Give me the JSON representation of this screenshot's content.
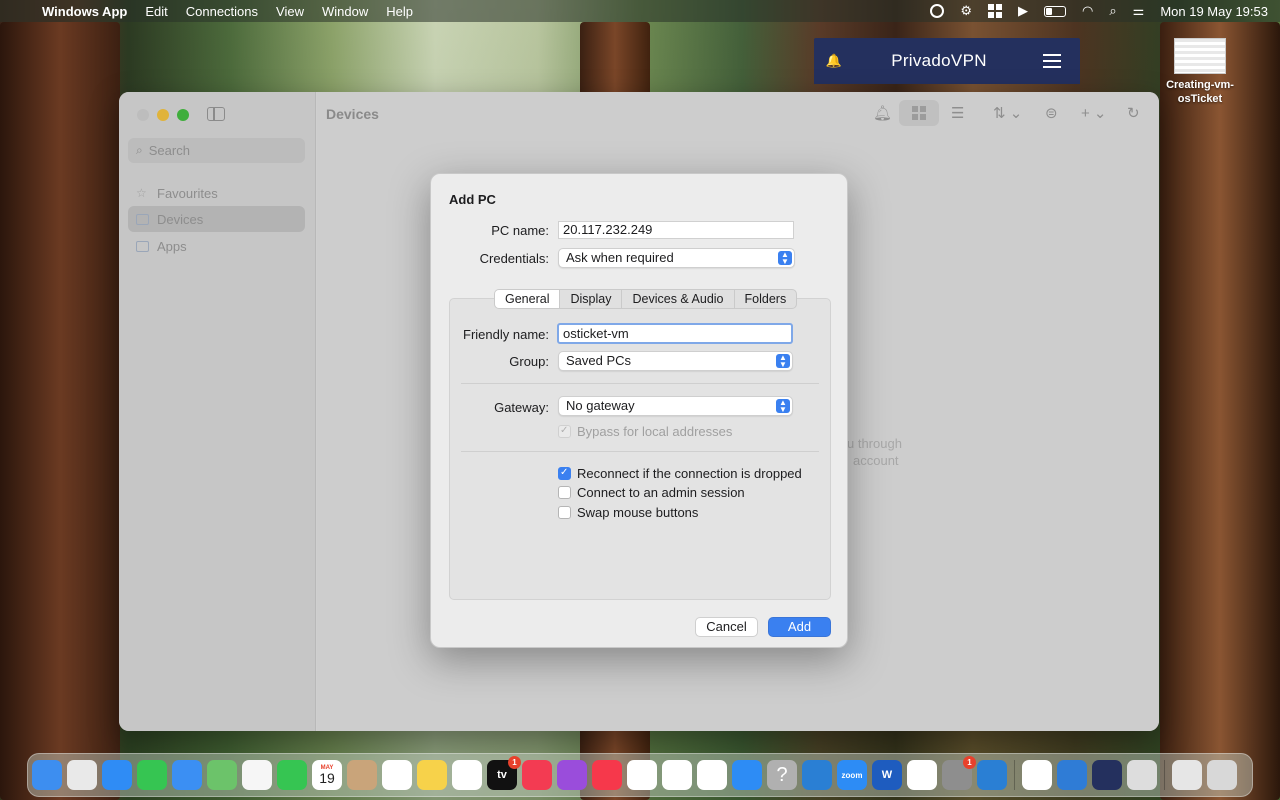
{
  "menubar": {
    "app_name": "Windows App",
    "items": [
      "Edit",
      "Connections",
      "View",
      "Window",
      "Help"
    ],
    "clock": "Mon 19 May  19:53"
  },
  "vpn": {
    "title": "PrivadoVPN"
  },
  "desktop_file": {
    "label": "Creating-vm-osTicket"
  },
  "window": {
    "title": "Devices",
    "search_placeholder": "Search",
    "sidebar": [
      {
        "label": "Favourites",
        "icon": "star-icon"
      },
      {
        "label": "Devices",
        "icon": "monitor-icon"
      },
      {
        "label": "Apps",
        "icon": "apps-grid-icon"
      }
    ],
    "background_hint_line1": "u through",
    "background_hint_line2": "account"
  },
  "dialog": {
    "title": "Add PC",
    "pc_name_label": "PC name:",
    "pc_name_value": "20.117.232.249",
    "credentials_label": "Credentials:",
    "credentials_value": "Ask when required",
    "tabs": [
      "General",
      "Display",
      "Devices & Audio",
      "Folders"
    ],
    "active_tab": "General",
    "friendly_name_label": "Friendly name:",
    "friendly_name_value": "osticket-vm",
    "group_label": "Group:",
    "group_value": "Saved PCs",
    "gateway_label": "Gateway:",
    "gateway_value": "No gateway",
    "bypass_label": "Bypass for local addresses",
    "reconnect_label": "Reconnect if the connection is dropped",
    "admin_label": "Connect to an admin session",
    "swap_label": "Swap mouse buttons",
    "cancel_label": "Cancel",
    "add_label": "Add"
  },
  "dock": {
    "calendar_month": "MAY",
    "calendar_day": "19",
    "tv_badge": "1",
    "settings_badge": "1",
    "tv_label": "tv",
    "zoom_label": "zoom",
    "word_label": "W",
    "help_label": "?",
    "icons": [
      {
        "name": "finder-icon",
        "color": "#3d8ef0"
      },
      {
        "name": "launchpad-icon",
        "color": "#e9e9e9"
      },
      {
        "name": "safari-icon",
        "color": "#2f8cf5"
      },
      {
        "name": "messages-icon",
        "color": "#36c552"
      },
      {
        "name": "mail-icon",
        "color": "#3b8ff3"
      },
      {
        "name": "maps-icon",
        "color": "#6cc36a"
      },
      {
        "name": "photos-icon",
        "color": "#f6f6f6"
      },
      {
        "name": "facetime-icon",
        "color": "#36c552"
      },
      {
        "name": "calendar-icon",
        "color": "#ffffff"
      },
      {
        "name": "contacts-icon",
        "color": "#c9a47a"
      },
      {
        "name": "reminders-icon",
        "color": "#ffffff"
      },
      {
        "name": "notes-icon",
        "color": "#f7d24a"
      },
      {
        "name": "freeform-icon",
        "color": "#ffffff"
      },
      {
        "name": "appletv-icon",
        "color": "#111111"
      },
      {
        "name": "music-icon",
        "color": "#f33b52"
      },
      {
        "name": "podcasts-icon",
        "color": "#9a4ddb"
      },
      {
        "name": "news-icon",
        "color": "#f6384b"
      },
      {
        "name": "keynote-icon",
        "color": "#ffffff"
      },
      {
        "name": "numbers-icon",
        "color": "#ffffff"
      },
      {
        "name": "pages-icon",
        "color": "#ffffff"
      },
      {
        "name": "appstore-icon",
        "color": "#2d8cf5"
      },
      {
        "name": "help-icon",
        "color": "#b0b0b0"
      },
      {
        "name": "vscode-icon",
        "color": "#2a7fd4"
      },
      {
        "name": "zoom-icon",
        "color": "#2d8cf5"
      },
      {
        "name": "word-icon",
        "color": "#1e5cbf"
      },
      {
        "name": "slack-icon",
        "color": "#ffffff"
      },
      {
        "name": "system-settings-icon",
        "color": "#8e8e8e"
      },
      {
        "name": "vscode-2-icon",
        "color": "#2a7fd4"
      },
      {
        "name": "chrome-icon",
        "color": "#ffffff"
      },
      {
        "name": "windows-app-icon",
        "color": "#2f7cd6"
      },
      {
        "name": "privadovpn-icon",
        "color": "#24305e"
      },
      {
        "name": "preview-icon",
        "color": "#dddddd"
      },
      {
        "name": "downloads-icon",
        "color": "#e6e6e6"
      },
      {
        "name": "trash-icon",
        "color": "#d8d8d8"
      }
    ]
  }
}
